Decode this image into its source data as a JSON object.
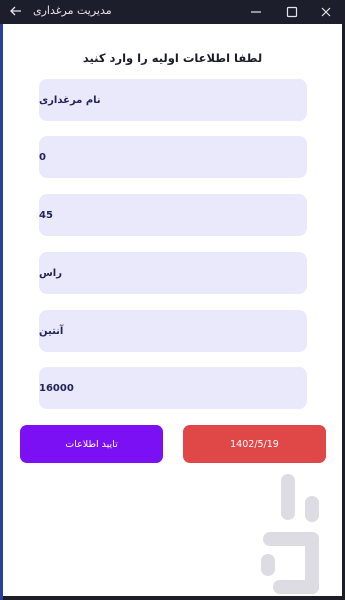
{
  "window": {
    "title": "مدیریت مرغداری",
    "back_icon": "arrow-left-icon",
    "minimize_icon": "minimize-icon",
    "maximize_icon": "maximize-icon",
    "close_icon": "close-icon"
  },
  "form": {
    "heading": "لطفا اطلاعات اولیه را وارد کنید",
    "fields": [
      {
        "value": "نام مرغداری"
      },
      {
        "value": "0"
      },
      {
        "value": "45"
      },
      {
        "value": "راس"
      },
      {
        "value": "آنتین"
      },
      {
        "value": "16000"
      }
    ]
  },
  "buttons": {
    "confirm_label": "تایید اطلاعات",
    "date_label": "1402/5/19"
  },
  "colors": {
    "confirm": "#7c10f5",
    "date": "#e04848",
    "field_bg": "#eae9fb",
    "field_text": "#23235a"
  }
}
